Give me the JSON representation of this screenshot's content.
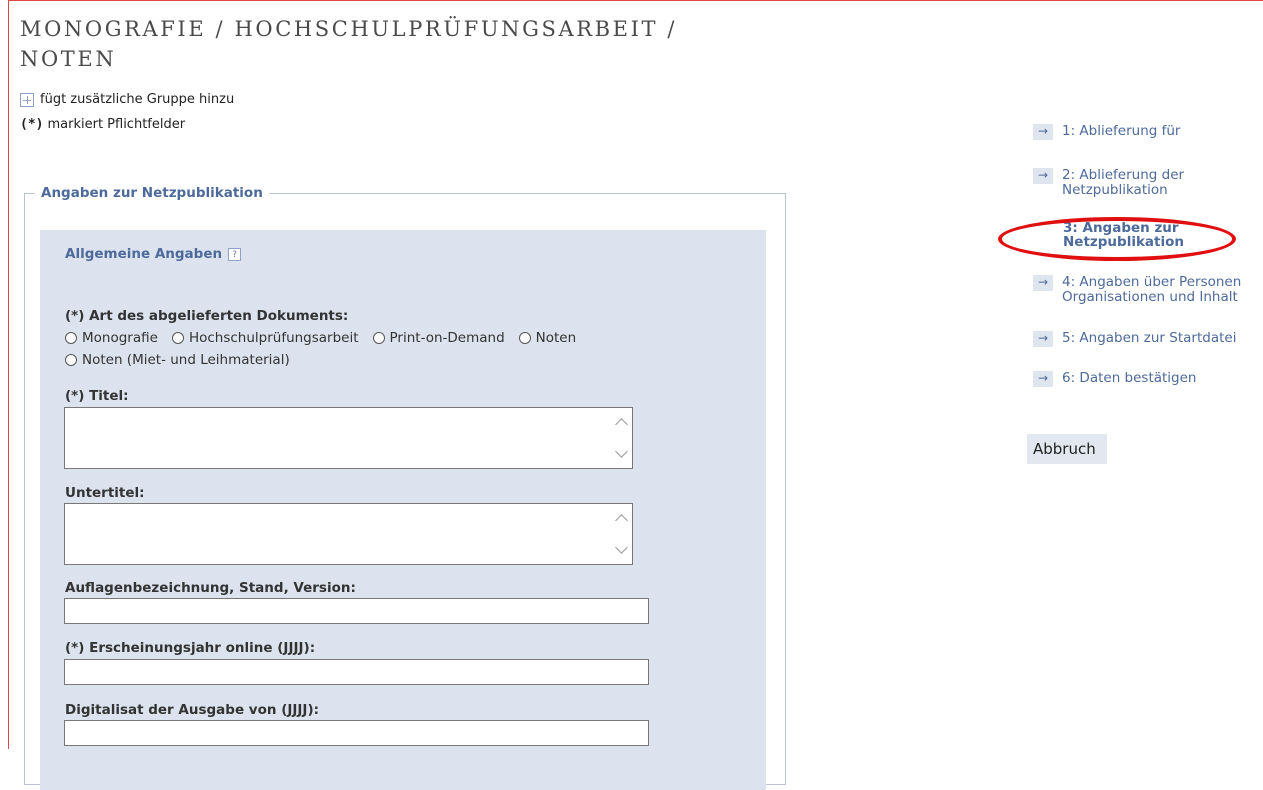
{
  "header": {
    "title": "MONOGRAFIE / HOCHSCHULPRÜFUNGSARBEIT / NOTEN",
    "legend_add_group": "fügt zusätzliche Gruppe hinzu",
    "legend_required_marker": "(*)",
    "legend_required": "markiert Pflichtfelder"
  },
  "form": {
    "fieldset_legend": "Angaben zur Netzpublikation",
    "section_title": "Allgemeine Angaben",
    "help_label": "?",
    "doc_type": {
      "label": "(*) Art des abgelieferten Dokuments:",
      "options": [
        "Monografie",
        "Hochschulprüfungsarbeit",
        "Print-on-Demand",
        "Noten",
        "Noten (Miet- und Leihmaterial)"
      ],
      "selected": null
    },
    "titel": {
      "label": "(*) Titel:",
      "value": ""
    },
    "untertitel": {
      "label": "Untertitel:",
      "value": ""
    },
    "auflage": {
      "label": "Auflagenbezeichnung, Stand, Version:",
      "value": ""
    },
    "erscheinungsjahr": {
      "label": "(*) Erscheinungsjahr online (JJJJ):",
      "value": ""
    },
    "digitalisat": {
      "label": "Digitalisat der Ausgabe von (JJJJ):",
      "value": ""
    }
  },
  "steps": {
    "items": [
      {
        "label": "1: Ablieferung für"
      },
      {
        "label_1": "2: Ablieferung der",
        "label_2": "Netzpublikation"
      },
      {
        "label_1": "3: Angaben zur",
        "label_2": "Netzpublikation",
        "active": true
      },
      {
        "label_1": "4: Angaben über Personen",
        "label_2": "Organisationen und Inhalt"
      },
      {
        "label": "5: Angaben zur Startdatei"
      },
      {
        "label": "6: Daten bestätigen"
      }
    ],
    "arrow_glyph": "→",
    "highlight_color": "#e01010"
  },
  "actions": {
    "cancel_label": "Abbruch"
  },
  "colors": {
    "accent": "#4d6a9a",
    "panel_bg": "#dde3ee",
    "frame_border": "#e04848"
  }
}
